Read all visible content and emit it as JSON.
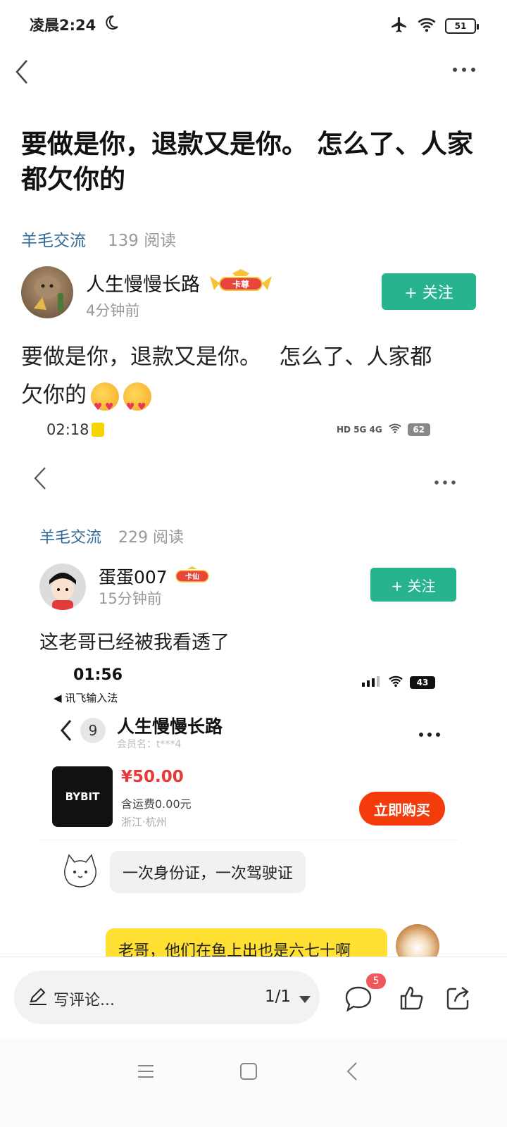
{
  "status_bar": {
    "time": "凌晨2:24",
    "battery": "51"
  },
  "post": {
    "title": "要做是你，退款又是你。 怎么了、人家都欠你的",
    "category": "羊毛交流",
    "reads": "139 阅读",
    "author": {
      "name": "人生慢慢长路",
      "badge": "卡尊",
      "time": "4分钟前"
    },
    "follow_label": "+ 关注",
    "body_line1": "要做是你，退款又是你。　 怎么了、人家都",
    "body_line2": "欠你的"
  },
  "embedded_1": {
    "time": "02:18",
    "status_text": "HD 5G 4G",
    "battery": "62",
    "category": "羊毛交流",
    "reads": "229 阅读",
    "author": {
      "name": "蛋蛋007",
      "badge": "卡仙",
      "time": "15分钟前"
    },
    "follow_label": "+ 关注",
    "text": "这老哥已经被我看透了"
  },
  "embedded_2": {
    "time": "01:56",
    "back_app": "◀ 讯飞输入法",
    "battery": "43",
    "unread_count": "9",
    "chat_name": "人生慢慢长路",
    "member": "会员名：t***4",
    "product_brand": "BYBIT",
    "price": "¥50.00",
    "shipping": "含运费0.00元",
    "location": "浙江·杭州",
    "buy_label": "立即购买",
    "message_left": "一次身份证，一次驾驶证",
    "message_right": "老哥，他们在鱼上出也是六七十啊"
  },
  "bottom": {
    "comment_placeholder": "写评论...",
    "page": "1/1",
    "comment_count": "5"
  },
  "colors": {
    "accent": "#26b38e",
    "link": "#2f6a99",
    "price": "#e63a3a",
    "buy": "#f33b0b"
  }
}
